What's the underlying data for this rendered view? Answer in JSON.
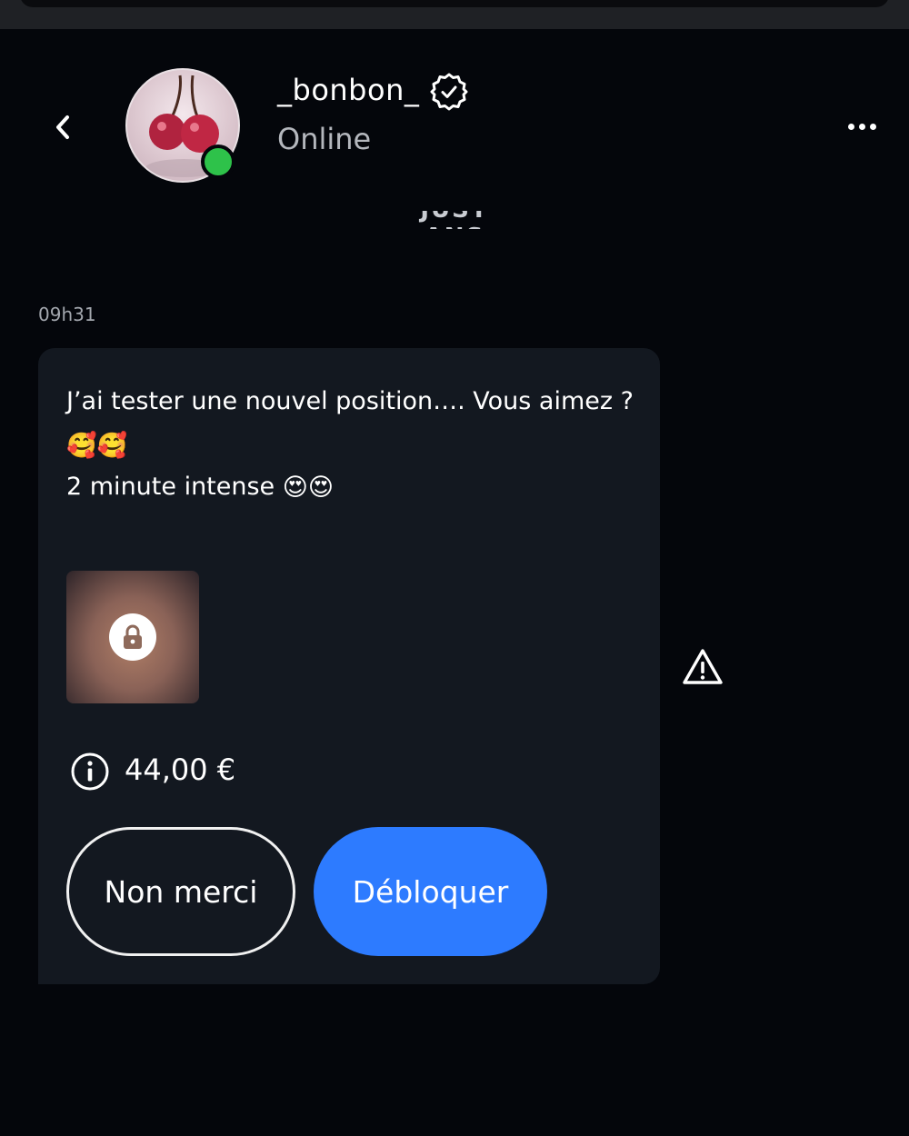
{
  "header": {
    "username": "_bonbon_",
    "status": "Online",
    "icons": {
      "back": "chevron-left-icon",
      "verified": "verified-badge-icon",
      "more": "more-horizontal-icon"
    },
    "online_color": "#2ec24a"
  },
  "date_separator": "JUST ANS",
  "message": {
    "timestamp": "09h31",
    "line1": "J’ai tester une nouvel position…. Vous aimez ?",
    "line2_emoji": "🥰🥰",
    "line3_text": "2 minute intense",
    "line3_emoji": "😍😍",
    "media": {
      "locked": true,
      "icon": "lock-icon"
    },
    "price": "44,00 €",
    "price_icon": "info-icon",
    "decline_label": "Non merci",
    "unlock_label": "Débloquer",
    "report_icon": "warning-triangle-icon"
  },
  "colors": {
    "background": "#04060b",
    "bubble": "#131820",
    "accent": "#2d7bff"
  }
}
